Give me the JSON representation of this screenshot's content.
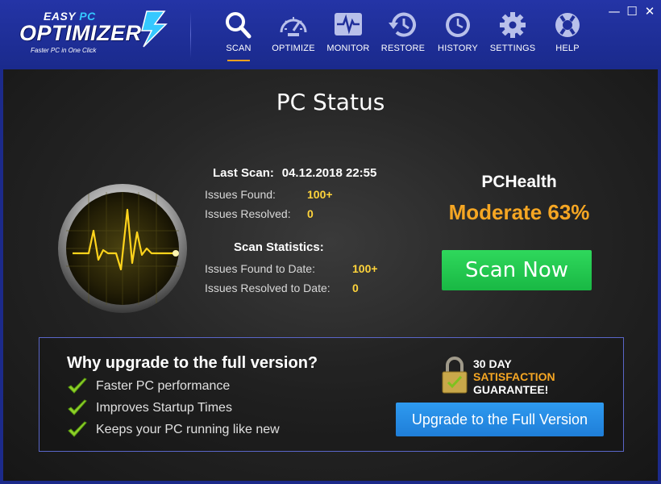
{
  "app": {
    "logo_easy": "EASY",
    "logo_pc": "PC",
    "logo_name": "OPTIMIZER",
    "logo_tagline": "Faster PC in One Click"
  },
  "nav": [
    {
      "label": "SCAN",
      "icon": "search-icon",
      "active": true
    },
    {
      "label": "OPTIMIZE",
      "icon": "speedometer-icon"
    },
    {
      "label": "MONITOR",
      "icon": "monitor-pulse-icon"
    },
    {
      "label": "RESTORE",
      "icon": "restore-clock-icon"
    },
    {
      "label": "HISTORY",
      "icon": "clock-icon"
    },
    {
      "label": "SETTINGS",
      "icon": "gear-icon"
    },
    {
      "label": "HELP",
      "icon": "lifebuoy-icon"
    }
  ],
  "window": {
    "minimize": "—",
    "maximize": "☐",
    "close": "✕"
  },
  "status": {
    "title": "PC Status",
    "last_scan_label": "Last Scan:",
    "last_scan_value": "04.12.2018 22:55",
    "issues_found_label": "Issues Found:",
    "issues_found_value": "100+",
    "issues_resolved_label": "Issues Resolved:",
    "issues_resolved_value": "0",
    "stats_label": "Scan Statistics:",
    "found_to_date_label": "Issues Found to Date:",
    "found_to_date_value": "100+",
    "resolved_to_date_label": "Issues Resolved to Date:",
    "resolved_to_date_value": "0"
  },
  "health": {
    "label": "PCHealth",
    "value": "Moderate 63%",
    "scan_button": "Scan Now"
  },
  "upgrade": {
    "title": "Why upgrade to the full version?",
    "features": [
      "Faster PC performance",
      "Improves Startup Times",
      "Keeps your PC running like new"
    ],
    "guarantee_line1": "30 DAY",
    "guarantee_line2": "SATISFACTION",
    "guarantee_line3": "GUARANTEE!",
    "button": "Upgrade to the Full Version"
  },
  "colors": {
    "header_blue": "#1f2e9a",
    "accent_orange": "#f5a623",
    "value_yellow": "#ffd43b",
    "scan_green": "#21c74f",
    "upgrade_blue": "#2a8ae6"
  }
}
